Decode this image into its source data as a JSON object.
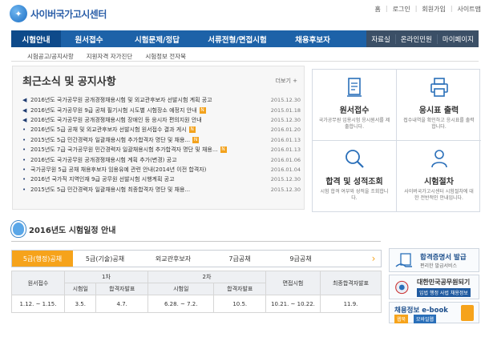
{
  "header": {
    "site_name": "사이버국가고시센터",
    "util_links": [
      "홈",
      "로그인",
      "회원가입",
      "사이트맵"
    ]
  },
  "gnb": {
    "tabs": [
      "시험안내",
      "원서접수",
      "시험문제/정답",
      "서류전형/면접시험",
      "채용후보자"
    ],
    "side_links": [
      "자료실",
      "온라인민원",
      "마이페이지"
    ]
  },
  "subnav": [
    "시험공고/공지사항",
    "지원자격 자가진단",
    "시험정보 전자북"
  ],
  "news": {
    "title": "최근소식 및 공지사항",
    "more": "더보기 +",
    "items": [
      {
        "icon": "speaker",
        "text": "2016년도 국가공무원 공개경쟁채용시험 및 외교관후보자 선발시험 계획 공고",
        "date": "2015.12.30",
        "new": false
      },
      {
        "icon": "speaker",
        "text": "2016년도 국가공무원 9급 공채 필기시험 시도별 시험장소 예정지 안내",
        "date": "2015.01.18",
        "new": true
      },
      {
        "icon": "speaker",
        "text": "2016년도 국가공무원 공개경쟁채용시험 장애인 등 응시자 편의지원 안내",
        "date": "2015.12.30",
        "new": false
      },
      {
        "icon": "bullet",
        "text": "2016년도 5급 공채 및 외교관후보자 선발시험 원서접수 결과 게시",
        "date": "2016.01.20",
        "new": true
      },
      {
        "icon": "bullet",
        "text": "2015년도 5급 민간경력자 일괄채용시험 추가합격자 명단 및 채용...",
        "date": "2016.01.13",
        "new": true
      },
      {
        "icon": "bullet",
        "text": "2015년도 7급 국가공무원 민간경력자 일괄채용시험 추가합격자 명단 및 채용...",
        "date": "2016.01.13",
        "new": true
      },
      {
        "icon": "bullet",
        "text": "2016년도 국가공무원 공개경쟁채용시험 계획 추가(변경) 공고",
        "date": "2016.01.06",
        "new": false
      },
      {
        "icon": "bullet",
        "text": "국가공무원 5급 공채 채용후보자 임용유예 관련 안내(2014년 이전 합격자)",
        "date": "2016.01.04",
        "new": false
      },
      {
        "icon": "bullet",
        "text": "2016년 국가직 지역인재 9급 공무원 선발시험 시행계획 공고",
        "date": "2015.12.30",
        "new": false
      },
      {
        "icon": "bullet",
        "text": "2015년도 5급 민간경력자 일괄채용시험 최종합격자 명단 및 채용...",
        "date": "2015.12.30",
        "new": false
      }
    ]
  },
  "cards": [
    {
      "title": "원서접수",
      "desc": "국가공무원 임용시험 응시원서를 제출합니다.",
      "icon": "document-icon"
    },
    {
      "title": "응시표 출력",
      "desc": "접수내역을 확인하고 응시표를 출력합니다.",
      "icon": "printer-icon"
    },
    {
      "title": "합격 및 성적조회",
      "desc": "시험 합격 여부와 성적을 조회합니다.",
      "icon": "search-icon"
    },
    {
      "title": "시험절차",
      "desc": "사이버국가고시센터 시험절차에 대한 전반적인 안내입니다.",
      "icon": "person-icon"
    }
  ],
  "schedule": {
    "title": "2016년도 시험일정 안내",
    "tabs": [
      "5급(행정)공채",
      "5급(기술)공채",
      "외교관후보자",
      "7급공채",
      "9급공채"
    ],
    "headers": {
      "apply": "원서접수",
      "round1": "1차",
      "round2": "2차",
      "interview": "면접시험",
      "final": "최종합격자발표",
      "exam_date": "시험일",
      "pass_announce": "합격자발표"
    },
    "row": [
      "1.12. ~ 1.15.",
      "3.5.",
      "4.7.",
      "6.28. ~ 7.2.",
      "10.5.",
      "10.21. ~ 10.22.",
      "11.9."
    ]
  },
  "banners": {
    "b1_title": "합격증명서 발급",
    "b1_sub": "편리한 발급서비스",
    "b2_title": "대한민국공무원되기",
    "b2_sub": "입법 행정 사법 채용정보",
    "b3_title": "채용정보 e-book",
    "b3_tag1": "웹북",
    "b3_tag2": "모바일웹"
  },
  "colors": {
    "primary": "#1d62a8",
    "accent": "#f6a31b"
  }
}
